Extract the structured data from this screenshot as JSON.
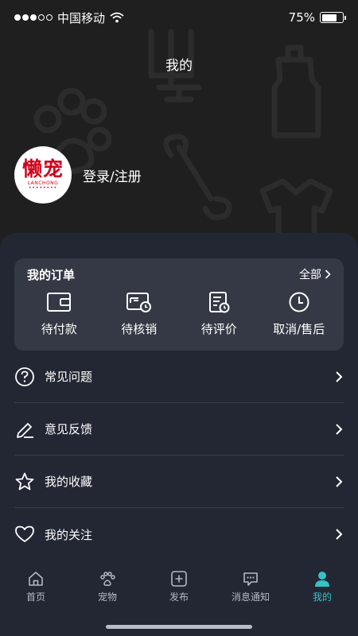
{
  "status_bar": {
    "carrier": "中国移动",
    "battery": "75%",
    "battery_level": 0.75
  },
  "header": {
    "title": "我的"
  },
  "profile": {
    "avatar_logo_text": "懒宠",
    "avatar_logo_sub": "LANCHONG",
    "login_label": "登录/注册"
  },
  "orders": {
    "title": "我的订单",
    "all_label": "全部",
    "items": [
      {
        "label": "待付款",
        "icon": "wallet-icon"
      },
      {
        "label": "待核销",
        "icon": "verify-card-icon"
      },
      {
        "label": "待评价",
        "icon": "review-document-icon"
      },
      {
        "label": "取消/售后",
        "icon": "clock-icon"
      }
    ]
  },
  "menu": {
    "items": [
      {
        "label": "常见问题",
        "icon": "question-icon"
      },
      {
        "label": "意见反馈",
        "icon": "pencil-icon"
      },
      {
        "label": "我的收藏",
        "icon": "star-icon"
      },
      {
        "label": "我的关注",
        "icon": "heart-icon"
      }
    ]
  },
  "tabbar": {
    "items": [
      {
        "label": "首页",
        "icon": "home-icon"
      },
      {
        "label": "宠物",
        "icon": "paw-icon"
      },
      {
        "label": "发布",
        "icon": "plus-square-icon"
      },
      {
        "label": "消息通知",
        "icon": "message-icon"
      },
      {
        "label": "我的",
        "icon": "person-icon"
      }
    ],
    "active_index": 4
  },
  "colors": {
    "accent": "#36c1c7",
    "panel": "#232733",
    "card": "#353945",
    "brand_red": "#d0021b"
  }
}
